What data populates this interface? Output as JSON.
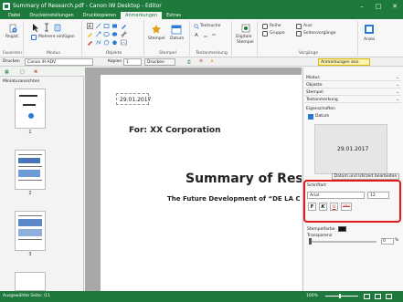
{
  "window": {
    "title": "Summary of Research.pdf - Canon iW Desktop - Editor",
    "controls": {
      "minimize": "–",
      "maximize": "□",
      "close": "✕"
    }
  },
  "menu": {
    "items": [
      "Datei",
      "Druckeinstellungen",
      "Druckkopieren",
      "Anmerkungen",
      "Extras"
    ],
    "active": "Anmerkungen"
  },
  "ribbon": {
    "favoriten": {
      "regist": "Regist.",
      "label": "Favoriten"
    },
    "modus": {
      "mehrere": "Mehrere einfügen",
      "label": "Modus"
    },
    "objekte": {
      "label": "Objekte"
    },
    "stempel": {
      "stempel": "Stempel",
      "datum": "Datum",
      "textsuche": "Textsuche",
      "label": "Stempel"
    },
    "textanmerkung": {
      "label": "Textanmerkung"
    },
    "digitale": {
      "line1": "Digitale",
      "line2": "Stempel"
    },
    "vorgaenge": {
      "reihe": "Reihe",
      "ausr": "Ausr",
      "gruppe": "Gruppe",
      "seitenvorgaenge": "Seitenvorgänge",
      "label": "Vorgänge"
    },
    "anzeige": {
      "label": "Anzei"
    }
  },
  "toolbar": {
    "drucken": "Drucken",
    "printer": "Canon iR-ADV",
    "kopien_label": "Kopien",
    "kopien_value": "1",
    "drucken_btn": "Drucken",
    "anmerkungen_anz": "Anmerkungen anz."
  },
  "leftpane": {
    "heading": "Miniaturansichten",
    "pages": [
      "1",
      "2",
      "3"
    ]
  },
  "document": {
    "date": "29.01.2017",
    "for_line": "For: XX Corporation",
    "title": "Summary of Rese",
    "subtitle": "The Future Development of “DE LA C"
  },
  "properties": {
    "sections": [
      "Modus",
      "Objekte",
      "Stempel",
      "Textanmerkung"
    ],
    "eigenschaften": "Eigenschaften",
    "datum": "Datum",
    "preview_date": "29.01.2017",
    "edit_button": "Datum und Uhrzeit bearbeiten",
    "schriftart_label": "Schriftart",
    "font_name": "Arial",
    "font_size": "12",
    "style_bold": "F",
    "style_italic": "K",
    "style_underline": "U",
    "style_strike": "abc",
    "stempelfarbe": "Stempelfarbe",
    "transparenz": "Transparenz",
    "transparenz_value": "0",
    "percent": "%",
    "highlight_color": "#e11b1b"
  },
  "statusbar": {
    "left": "Ausgewählte Seite: /11",
    "zoom": "100%"
  }
}
